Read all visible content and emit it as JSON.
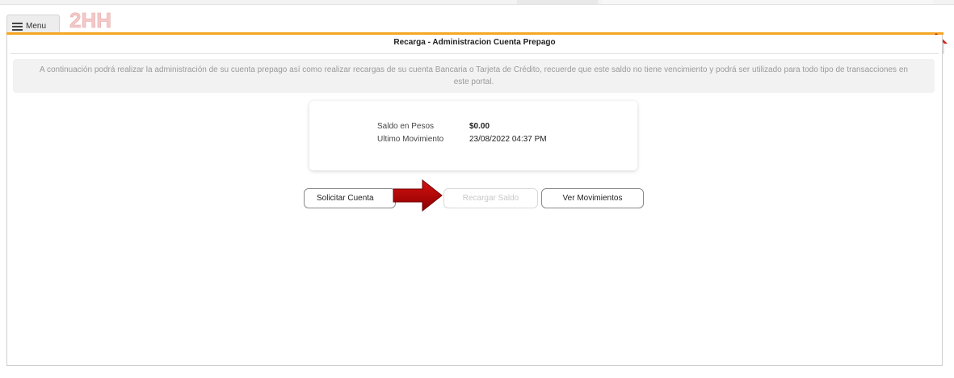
{
  "header": {
    "menu_label": "Menu",
    "logo_text": "2HH"
  },
  "page": {
    "title": "Recarga - Administracion Cuenta Prepago",
    "info_text": "A continuación podrá realizar la administración de su cuenta prepago así como realizar recargas de su cuenta Bancaria o Tarjeta de Crédito, recuerde que este saldo no tiene vencimiento y podrá ser utilizado para todo tipo de transacciones en este portal."
  },
  "balance": {
    "saldo_label": "Saldo en Pesos",
    "saldo_value": "$0.00",
    "movimiento_label": "Ultimo Movimiento",
    "movimiento_value": "23/08/2022 04:37 PM"
  },
  "actions": {
    "solicitar_label": "Solicitar Cuenta",
    "recargar_label": "Recargar Saldo",
    "ver_label": "Ver Movimientos"
  },
  "colors": {
    "accent": "#f5a623",
    "arrow": "#b30000",
    "home_roof": "#d21f1f"
  },
  "icons": {
    "menu": "hamburger-icon",
    "home": "home-icon",
    "pointer": "red-arrow-icon"
  }
}
